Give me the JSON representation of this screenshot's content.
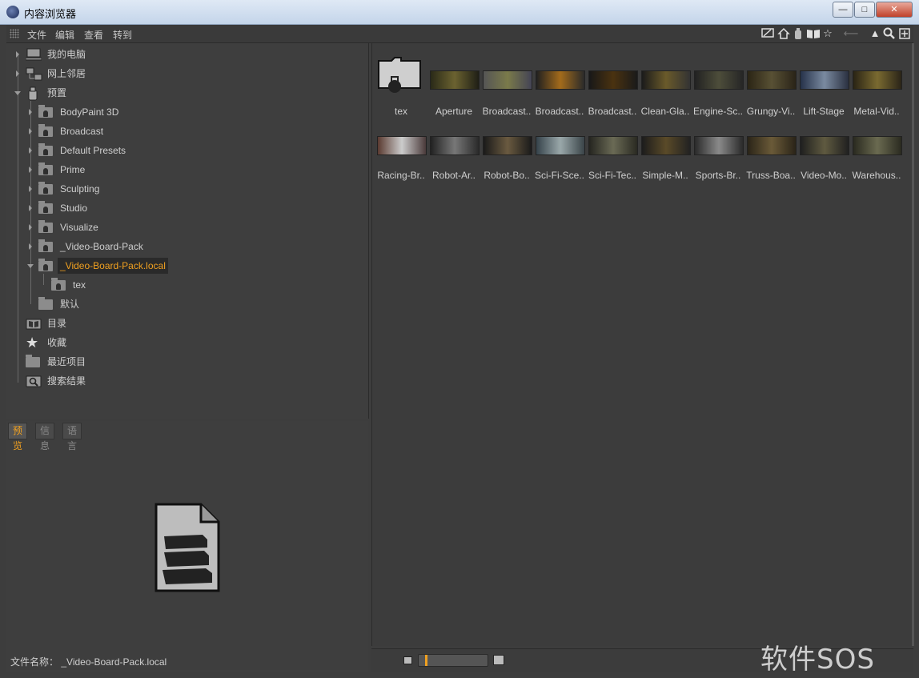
{
  "window": {
    "title": "内容浏览器",
    "min": "—",
    "max": "□",
    "close": "✕"
  },
  "menu": [
    "文件",
    "编辑",
    "查看",
    "转到"
  ],
  "toolbar_icons": [
    "edit-icon",
    "home-icon",
    "preset-icon",
    "book-icon",
    "star-icon",
    "back-arrow-icon",
    "up-arrow-icon",
    "search-icon",
    "new-window-icon"
  ],
  "tree": [
    {
      "label": "我的电脑",
      "icon": "computer-icon"
    },
    {
      "label": "网上邻居",
      "icon": "network-icon"
    },
    {
      "label": "预置",
      "icon": "preset-icon"
    },
    {
      "label": "BodyPaint 3D",
      "icon": "locked-folder-icon"
    },
    {
      "label": "Broadcast",
      "icon": "locked-folder-icon"
    },
    {
      "label": "Default Presets",
      "icon": "locked-folder-icon"
    },
    {
      "label": "Prime",
      "icon": "locked-folder-icon"
    },
    {
      "label": "Sculpting",
      "icon": "locked-folder-icon"
    },
    {
      "label": "Studio",
      "icon": "locked-folder-icon"
    },
    {
      "label": "Visualize",
      "icon": "locked-folder-icon"
    },
    {
      "label": "_Video-Board-Pack",
      "icon": "locked-folder-icon"
    },
    {
      "label": "_Video-Board-Pack.local",
      "icon": "locked-folder-open-icon",
      "selected": true
    },
    {
      "label": "tex",
      "icon": "locked-folder-icon"
    },
    {
      "label": "默认",
      "icon": "folder-icon"
    },
    {
      "label": "目录",
      "icon": "catalog-icon"
    },
    {
      "label": "收藏",
      "icon": "star-icon"
    },
    {
      "label": "最近项目",
      "icon": "folder-icon"
    },
    {
      "label": "搜索结果",
      "icon": "search-folder-icon"
    }
  ],
  "tabs": [
    "预览",
    "信息",
    "语言"
  ],
  "filename_label": "文件名称：",
  "filename_value": "_Video-Board-Pack.local",
  "thumbnails": [
    "tex",
    "Aperture",
    "Broadcast..",
    "Broadcast..",
    "Broadcast..",
    "Clean-Gla..",
    "Engine-Sc..",
    "Grungy-Vi..",
    "Lift-Stage",
    "Metal-Vid..",
    "Racing-Br..",
    "Robot-Ar..",
    "Robot-Bo..",
    "Sci-Fi-Sce..",
    "Sci-Fi-Tec..",
    "Simple-M..",
    "Sports-Br..",
    "Truss-Boa..",
    "Video-Mo..",
    "Warehous.."
  ],
  "zoom_slider_value": 0.1,
  "watermark": "软件SOS",
  "colors": {
    "accent": "#f0a020",
    "background": "#3d3d3d"
  }
}
